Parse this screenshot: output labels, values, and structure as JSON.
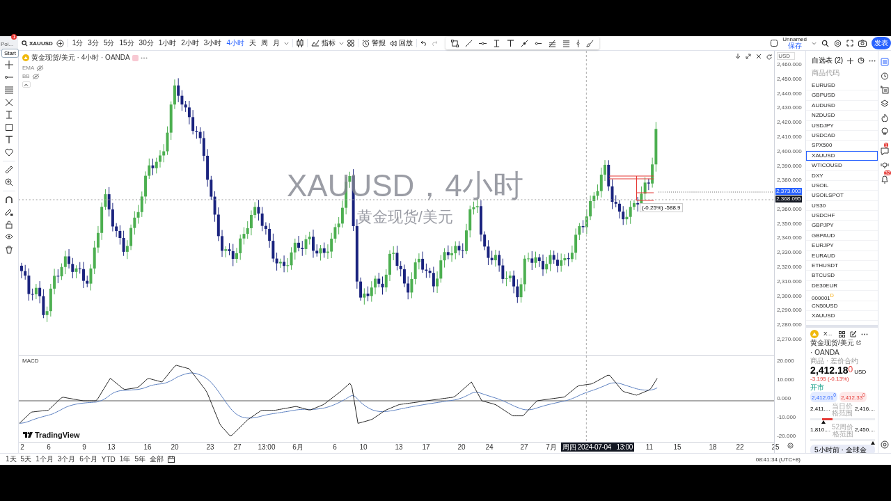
{
  "browser_tab": {
    "label": "Poi...",
    "badge": "1"
  },
  "tooltip": "Start",
  "toolbar": {
    "symbol": "XAUUSD",
    "intervals": [
      {
        "label": "1分",
        "selected": false
      },
      {
        "label": "3分",
        "selected": false
      },
      {
        "label": "5分",
        "selected": false
      },
      {
        "label": "15分",
        "selected": false
      },
      {
        "label": "30分",
        "selected": false
      },
      {
        "label": "1小时",
        "selected": false
      },
      {
        "label": "2小时",
        "selected": false
      },
      {
        "label": "3小时",
        "selected": false
      },
      {
        "label": "4小时",
        "selected": true
      },
      {
        "label": "天",
        "selected": false
      },
      {
        "label": "周",
        "selected": false
      },
      {
        "label": "月",
        "selected": false
      }
    ],
    "indicators_button": "指标",
    "alert_button": "警报",
    "replay_button": "回放",
    "layout_name": "Unnamed",
    "layout_status": "保存",
    "publish_button": "发表"
  },
  "chart": {
    "legend_title": "黄金现货/美元 · 4小时 · OANDA",
    "indicators": [
      {
        "name": "EMA",
        "visible": false
      },
      {
        "name": "BB",
        "visible": false
      }
    ],
    "watermark_symbol": "XAUUSD，4小时",
    "watermark_name": "黄金现货/美元",
    "position_label": "(-0.25%) -588.9",
    "macd_title": "MACD",
    "brand": "TradingView"
  },
  "price_axis": {
    "currency": "USD",
    "ticks": [
      "2,460.000",
      "2,450.000",
      "2,440.000",
      "2,430.000",
      "2,420.000",
      "2,410.000",
      "2,400.000",
      "2,390.000",
      "2,380.000",
      "2,360.000",
      "2,350.000",
      "2,340.000",
      "2,330.000",
      "2,320.000",
      "2,310.000",
      "2,300.000",
      "2,290.000",
      "2,280.000",
      "2,270.000"
    ],
    "labels": [
      {
        "text": "2,373.003",
        "kind": "alert"
      },
      {
        "text": "2,368.095",
        "kind": "last"
      }
    ],
    "macd_ticks": [
      "20.000",
      "10.000",
      "0.000",
      "-10.000",
      "-20.000"
    ]
  },
  "time_axis": {
    "ticks": [
      "2",
      "6",
      "9",
      "13",
      "16",
      "20",
      "23",
      "27",
      "13:00",
      "6月",
      "6",
      "10",
      "13",
      "17",
      "20",
      "24",
      "27",
      "7月",
      "11",
      "15",
      "18",
      "22",
      "25"
    ],
    "crosshair_label": "周四 2024-07-04   13:00"
  },
  "bottom_bar": {
    "ranges": [
      "1天",
      "5天",
      "1个月",
      "3个月",
      "6个月",
      "YTD",
      "1年",
      "5年",
      "全部"
    ],
    "clock": "08:41:34 (UTC+8)"
  },
  "watchlist": {
    "title": "自选表 (2)",
    "column": "商品代码",
    "items": [
      {
        "symbol": "EURUSD",
        "selected": false
      },
      {
        "symbol": "GBPUSD",
        "selected": false
      },
      {
        "symbol": "AUDUSD",
        "selected": false
      },
      {
        "symbol": "NZDUSD",
        "selected": false
      },
      {
        "symbol": "USDJPY",
        "selected": false
      },
      {
        "symbol": "USDCAD",
        "selected": false
      },
      {
        "symbol": "SPX500",
        "selected": false
      },
      {
        "symbol": "XAUUSD",
        "selected": true
      },
      {
        "symbol": "WTICOUSD",
        "selected": false
      },
      {
        "symbol": "DXY",
        "selected": false
      },
      {
        "symbol": "USOIL",
        "selected": false
      },
      {
        "symbol": "USOILSPOT",
        "selected": false
      },
      {
        "symbol": "US30",
        "selected": false
      },
      {
        "symbol": "USDCHF",
        "selected": false
      },
      {
        "symbol": "GBPJPY",
        "selected": false
      },
      {
        "symbol": "GBPAUD",
        "selected": false
      },
      {
        "symbol": "EURJPY",
        "selected": false
      },
      {
        "symbol": "EURAUD",
        "selected": false
      },
      {
        "symbol": "ETHUSDT",
        "selected": false
      },
      {
        "symbol": "BTCUSD",
        "selected": false
      },
      {
        "symbol": "DE30EUR",
        "selected": false
      },
      {
        "symbol": "000001",
        "selected": false,
        "badge": "D"
      },
      {
        "symbol": "CN50USD",
        "selected": false
      },
      {
        "symbol": "XAUUSD",
        "selected": false
      }
    ]
  },
  "details": {
    "symbol": "X...",
    "name": "黄金现货/美元",
    "exchange": "· OANDA",
    "type": "商品 · 差价合约",
    "price": "2,412.18",
    "price_tail": "0",
    "currency": "USD",
    "change": "-3.195 (-0.13%)",
    "market_status": "开市",
    "bid": "2,412.01$^{0}$",
    "ask": "2,412.33$^{0}$",
    "ranges": [
      {
        "low": "2,411....",
        "label": "当日价格范围",
        "high": "2,416....",
        "level": 0.2
      },
      {
        "low": "1,810....",
        "label": "52周价格范围",
        "high": "2,450....",
        "level": 0.97
      }
    ],
    "news": "5小时前 · 全球金"
  },
  "side_icons": [
    {
      "kind": "watchlist"
    },
    {
      "kind": "alarm"
    },
    {
      "kind": "add-list"
    },
    {
      "kind": "layers"
    },
    {
      "kind": "flame"
    },
    {
      "kind": "bulb"
    },
    {
      "kind": "chat",
      "badge": "1"
    },
    {
      "kind": "broadcast"
    },
    {
      "kind": "bell",
      "badge": "32"
    }
  ]
}
